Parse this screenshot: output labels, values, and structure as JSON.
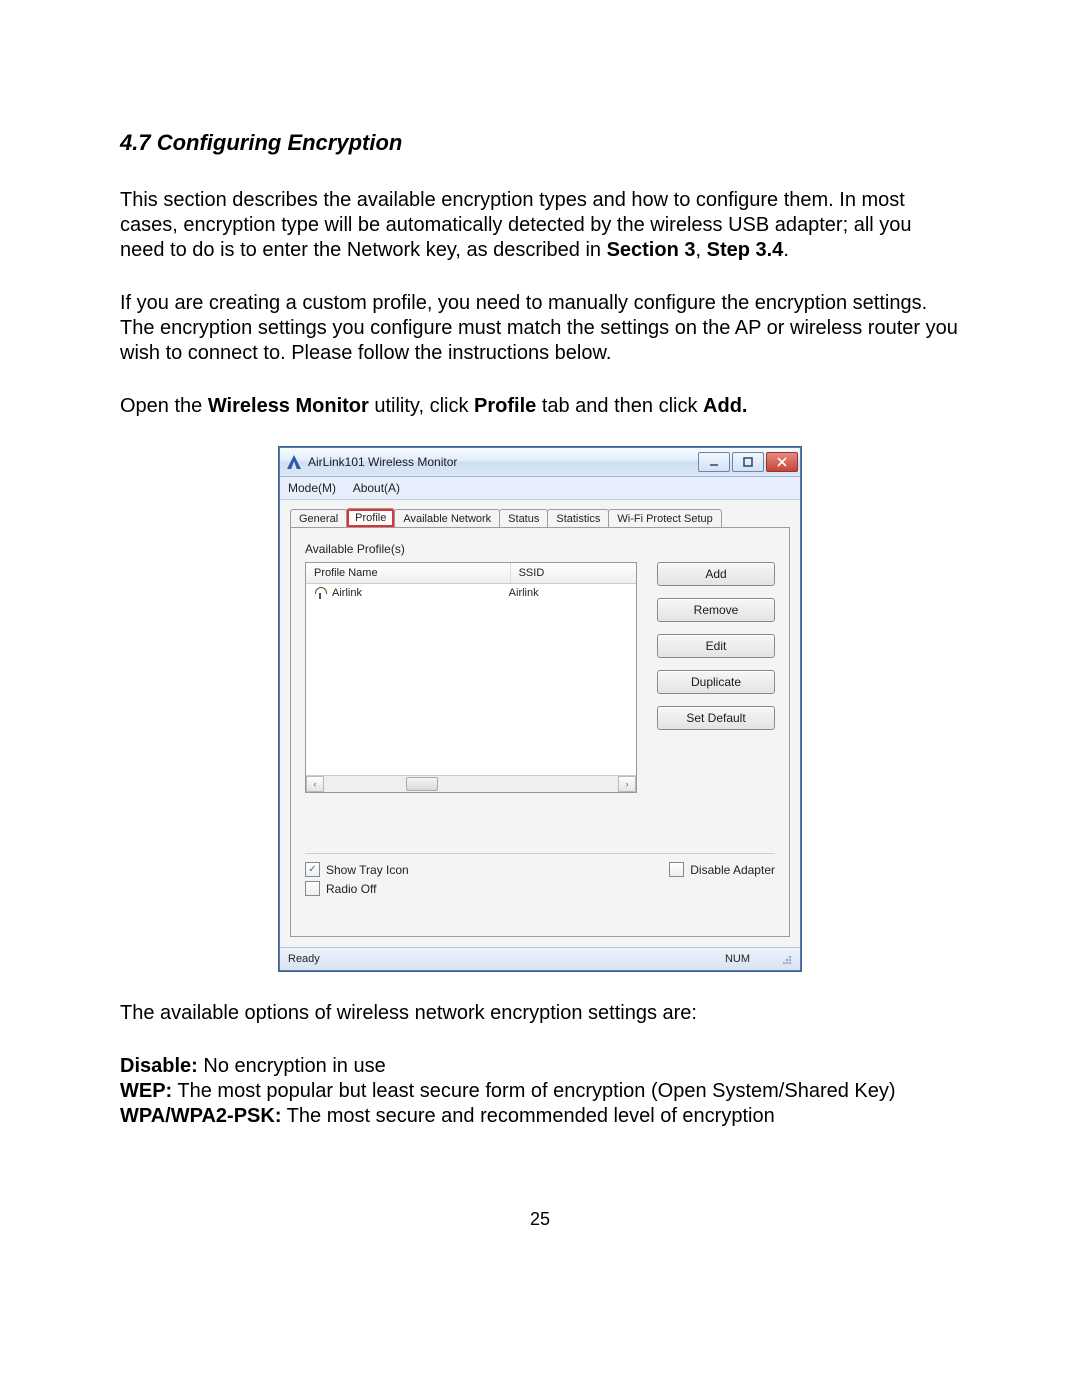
{
  "heading": "4.7 Configuring Encryption",
  "para1_a": "This section describes the available encryption types and how to configure them. In most cases, encryption type will be automatically detected by the wireless USB adapter; all you need to do is to enter the Network key, as described in ",
  "para1_b": "Section 3",
  "para1_c": ", ",
  "para1_d": "Step 3.4",
  "para1_e": ".",
  "para2": "If you are creating a custom profile, you need to manually configure the encryption settings. The encryption settings you configure must match the settings on the AP or wireless router you wish to connect to. Please follow the instructions below.",
  "para3_a": "Open the ",
  "para3_b": "Wireless Monitor",
  "para3_c": " utility, click ",
  "para3_d": "Profile",
  "para3_e": " tab and then click ",
  "para3_f": "Add.",
  "para4": "The available options of wireless network encryption settings are:",
  "opt1_b": "Disable:",
  "opt1_t": "  No encryption in use",
  "opt2_b": "WEP:",
  "opt2_t": "  The most popular but least secure form of encryption (Open System/Shared Key)",
  "opt3_b": "WPA/WPA2-PSK:",
  "opt3_t": "  The most secure and recommended level of encryption",
  "page_number": "25",
  "window": {
    "title": "AirLink101 Wireless Monitor",
    "menu": {
      "mode": "Mode(M)",
      "about": "About(A)"
    },
    "tabs": {
      "general": "General",
      "profile": "Profile",
      "available_network": "Available Network",
      "status": "Status",
      "statistics": "Statistics",
      "wps": "Wi-Fi Protect Setup"
    },
    "section_label": "Available Profile(s)",
    "columns": {
      "profile_name": "Profile Name",
      "ssid": "SSID"
    },
    "rows": [
      {
        "name": "Airlink",
        "ssid": "Airlink"
      }
    ],
    "buttons": {
      "add": "Add",
      "remove": "Remove",
      "edit": "Edit",
      "duplicate": "Duplicate",
      "set_default": "Set Default"
    },
    "checks": {
      "show_tray": "Show Tray Icon",
      "radio_off": "Radio Off",
      "disable_adapter": "Disable Adapter"
    },
    "status": {
      "ready": "Ready",
      "num": "NUM"
    }
  }
}
